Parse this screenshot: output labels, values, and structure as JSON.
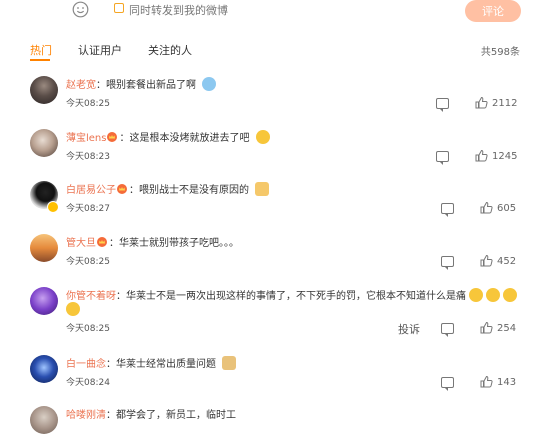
{
  "compose": {
    "emoji_icon": "smiley-face-icon",
    "repost_label": "同时转发到我的微博",
    "submit_label": "评论",
    "accent_color": "#ff8200"
  },
  "tabs": {
    "items": [
      "热门",
      "认证用户",
      "关注的人"
    ],
    "active": "热门",
    "total": "共598条"
  },
  "comments": [
    {
      "user": "赵老宽",
      "text": "喂别套餐出新品了啊",
      "time": "今天08:25",
      "likes": "2112",
      "emoji": "crying-emoji",
      "crown": false
    },
    {
      "user": "薄宝lens",
      "text": "这是根本没烤就放进去了吧",
      "time": "今天08:23",
      "likes": "1245",
      "emoji": "laughing-emoji",
      "crown": true
    },
    {
      "user": "白居易公子",
      "text": "喂别战士不是没有原因的",
      "time": "今天08:27",
      "likes": "605",
      "emoji": "cat-emoji",
      "crown": true,
      "verified": true
    },
    {
      "user": "管大旦",
      "text": "华莱士就别带孩子吃吧。。。",
      "time": "今天08:25",
      "likes": "452",
      "crown": true
    },
    {
      "user": "你管不着呀",
      "text": "华莱士不是一两次出现这样的事情了，不下死手的罚，它根本不知道什么是痛",
      "time": "今天08:25",
      "likes": "254",
      "emoji_count": 4,
      "crown": false,
      "report": "投诉"
    },
    {
      "user": "白一曲念",
      "text": "华莱士经常出质量问题",
      "time": "今天08:24",
      "likes": "143",
      "emoji": "hands-emoji",
      "crown": false
    },
    {
      "user": "哈喽刚清",
      "text": "都学会了，新员工，临时工",
      "crown": false
    }
  ]
}
